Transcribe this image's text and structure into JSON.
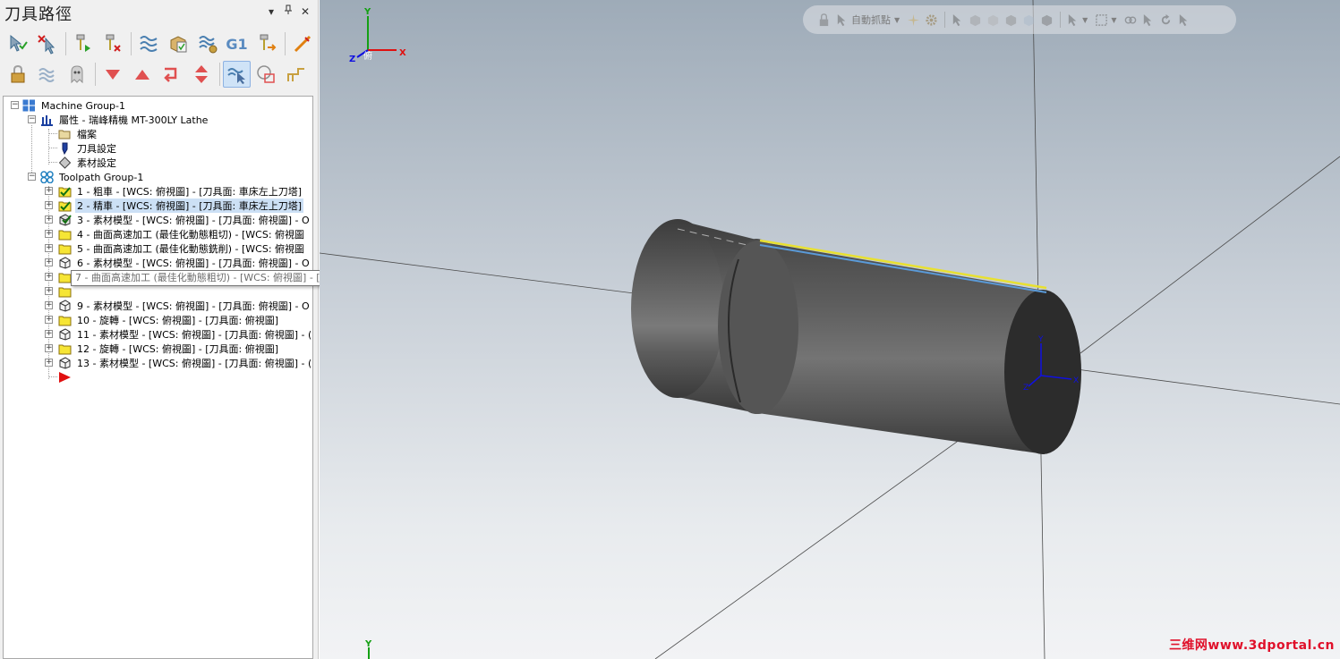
{
  "panel": {
    "title": "刀具路徑",
    "controls": {
      "dropdown": "▾",
      "pin": "ᵖ",
      "close": "✕"
    }
  },
  "tree": {
    "machine_group": "Machine Group-1",
    "properties": "屬性 - 瑞峰精機 MT-300LY Lathe",
    "files": "檔案",
    "tool_settings": "刀具設定",
    "stock_settings": "素材設定",
    "toolpath_group": "Toolpath Group-1",
    "operations": [
      {
        "label": "1 - 粗車 - [WCS: 俯視圖] - [刀具面: 車床左上刀塔]",
        "icon": "folder-check-icon"
      },
      {
        "label": "2 - 精車 - [WCS: 俯視圖] - [刀具面: 車床左上刀塔]",
        "icon": "folder-check-icon"
      },
      {
        "label": "3 - 素材模型 - [WCS: 俯視圖] - [刀具面: 俯視圖] - O",
        "icon": "stock-model-check-icon"
      },
      {
        "label": "4 - 曲面高速加工 (最佳化動態粗切) - [WCS: 俯視圖",
        "icon": "folder-icon"
      },
      {
        "label": "5 - 曲面高速加工 (最佳化動態銑削) - [WCS: 俯視圖",
        "icon": "folder-icon"
      },
      {
        "label": "6 - 素材模型 - [WCS: 俯視圖] - [刀具面: 俯視圖] - O",
        "icon": "stock-model-icon"
      },
      {
        "label": "",
        "icon": "folder-icon"
      },
      {
        "label": "",
        "icon": "folder-icon"
      },
      {
        "label": "9 - 素材模型 - [WCS: 俯視圖] - [刀具面: 俯視圖] - O",
        "icon": "stock-model-icon"
      },
      {
        "label": "10 - 旋轉 - [WCS: 俯視圖] - [刀具面: 俯視圖]",
        "icon": "folder-icon"
      },
      {
        "label": "11 - 素材模型 - [WCS: 俯視圖] - [刀具面: 俯視圖] - (",
        "icon": "stock-model-icon"
      },
      {
        "label": "12 - 旋轉 - [WCS: 俯視圖] - [刀具面: 俯視圖]",
        "icon": "folder-icon"
      },
      {
        "label": "13 - 素材模型 - [WCS: 俯視圖] - [刀具面: 俯視圖] - (",
        "icon": "stock-model-icon"
      }
    ],
    "tooltip": "7 - 曲面高速加工 (最佳化動態粗切) - [WCS: 俯視圖] - [刀具面: 後視圖]"
  },
  "toolbar": {
    "row1": [
      "select-all-operations-icon",
      "select-all-failed-icon",
      "regenerate-selected-icon",
      "regenerate-dirty-icon",
      "backplot-icon",
      "verify-icon",
      "simulate-icon",
      "post-g1-icon",
      "tool-manager-icon",
      "highfeed-icon"
    ],
    "row2": [
      "lock-icon",
      "toggle-display-icon",
      "ghost-icon",
      "move-down-icon",
      "move-up-icon",
      "insert-arrow-icon",
      "scroll-icon",
      "display-selected-icon",
      "stock-display-icon",
      "rapid-icon"
    ],
    "g1_label": "G1"
  },
  "viewport": {
    "auto_cursor_label": "自動抓點",
    "axis_labels": {
      "x": "X",
      "y": "Y",
      "z": "Z"
    },
    "gnomon_label": "俯",
    "watermark": "三维网www.3dportal.cn"
  },
  "colors": {
    "accent_blue": "#1a56c6",
    "selection": "#cce0f5",
    "folder_yellow": "#f6e535",
    "axis_red": "#e01010",
    "axis_green": "#14a014",
    "axis_blue": "#1010e0",
    "toolpath_yellow": "#e8e030",
    "toolpath_blue": "#5a9ad8"
  }
}
